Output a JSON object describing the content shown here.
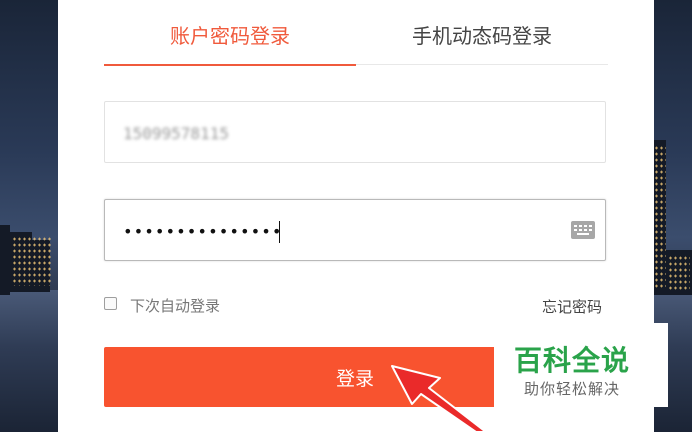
{
  "tabs": {
    "account_password": "账户密码登录",
    "sms_code": "手机动态码登录"
  },
  "username": {
    "value": "15099578115"
  },
  "password": {
    "value": "•••••••••••••••"
  },
  "remember": {
    "label": "下次自动登录"
  },
  "forgot": {
    "label": "忘记密码"
  },
  "login_button": {
    "label": "登录"
  },
  "watermark": {
    "title": "百科全说",
    "subtitle": "助你轻松解决"
  },
  "colors": {
    "accent": "#f05a3c",
    "button": "#f8532f",
    "watermark_green": "#2aa34a"
  }
}
